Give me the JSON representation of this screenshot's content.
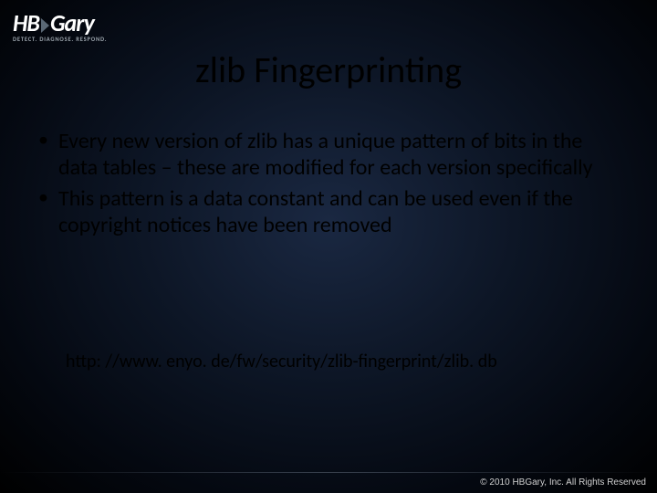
{
  "logo": {
    "hb": "HB",
    "gary": "Gary",
    "tagline": "DETECT. DIAGNOSE. RESPOND."
  },
  "title": "zlib Fingerprinting",
  "bullets": [
    "Every new version of zlib has a unique pattern of bits in the data tables – these are modified for each version specifically",
    "This pattern is a data constant and can be used even if the copyright notices have been removed"
  ],
  "reference": "http: //www. enyo. de/fw/security/zlib-fingerprint/zlib. db",
  "footer": "© 2010 HBGary, Inc. All Rights Reserved"
}
